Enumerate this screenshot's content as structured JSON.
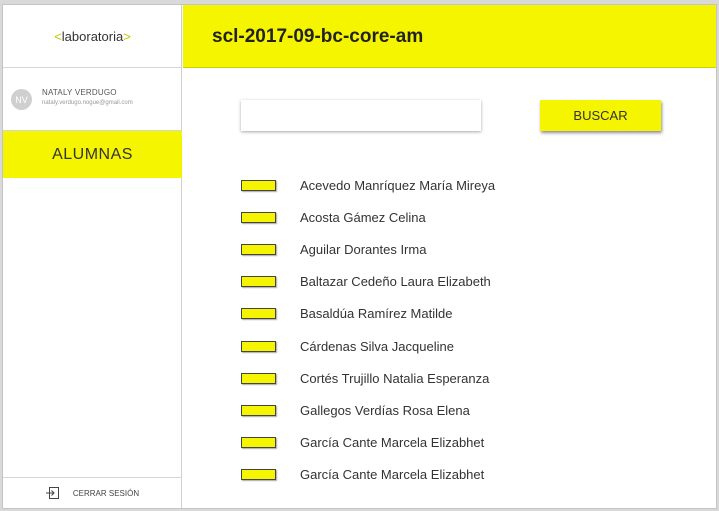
{
  "brand": {
    "name": "laboratoria",
    "bracket_left": "<",
    "bracket_right": ">"
  },
  "header": {
    "title": "scl-2017-09-bc-core-am"
  },
  "profile": {
    "initials": "NV",
    "name": "NATALY VERDUGO",
    "email": "nataly.verdugo.nogue@gmail.com"
  },
  "nav": {
    "active_label": "ALUMNAS"
  },
  "logout": {
    "label": "CERRAR SESIÓN",
    "icon": "logout-icon"
  },
  "search": {
    "value": "",
    "button_label": "BUSCAR"
  },
  "students": [
    "Acevedo Manríquez María Mireya",
    "Acosta Gámez Celina",
    "Aguilar Dorantes Irma",
    "Baltazar Cedeño Laura Elizabeth",
    "Basaldúa Ramírez Matilde",
    "Cárdenas Silva Jacqueline",
    "Cortés Trujillo Natalia Esperanza",
    "Gallegos Verdías Rosa Elena",
    "García Cante Marcela Elizabhet",
    "García Cante Marcela Elizabhet"
  ],
  "colors": {
    "accent": "#f5f500",
    "text": "#333333"
  }
}
